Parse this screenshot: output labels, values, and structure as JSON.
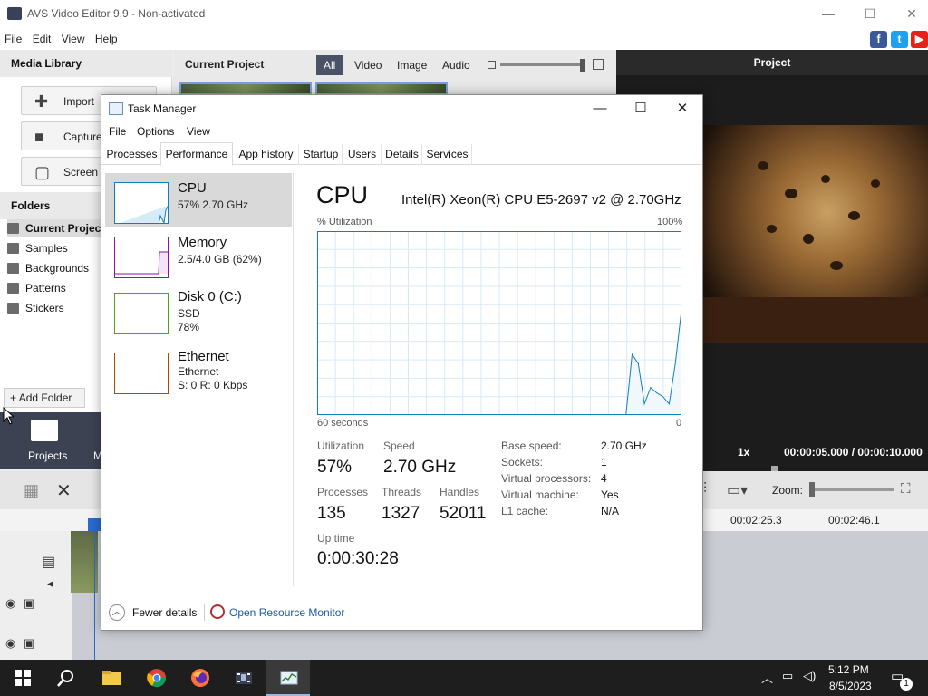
{
  "avs": {
    "window_title": "AVS Video Editor 9.9 - Non-activated",
    "menu": [
      "File",
      "Edit",
      "View",
      "Help"
    ],
    "social": [
      {
        "icon": "facebook-icon",
        "glyph": "f",
        "color": "#3b5998"
      },
      {
        "icon": "twitter-icon",
        "glyph": "t",
        "color": "#1da1f2"
      },
      {
        "icon": "youtube-icon",
        "glyph": "▶",
        "color": "#e62117"
      }
    ],
    "media_library": {
      "title": "Media Library",
      "buttons": [
        {
          "label": "Import",
          "icon": "plus-icon"
        },
        {
          "label": "Capture",
          "icon": "camera-icon"
        },
        {
          "label": "Screen C",
          "icon": "screen-capture-icon"
        }
      ],
      "folders_title": "Folders",
      "folders": [
        "Current Project",
        "Samples",
        "Backgrounds",
        "Patterns",
        "Stickers"
      ],
      "add_folder": "Add Folder"
    },
    "current_project": {
      "title": "Current Project",
      "filters": [
        "All",
        "Video",
        "Image",
        "Audio"
      ],
      "active_filter": "All"
    },
    "preview": {
      "title": "Project",
      "speed": "1x",
      "time": "00:00:05.000 / 00:00:10.000"
    },
    "projects_label": "Projects",
    "projects_label_partial": "M",
    "zoom_label": "Zoom:",
    "ruler_times": [
      "00:02:25.3",
      "00:02:46.1"
    ]
  },
  "task_manager": {
    "title": "Task Manager",
    "menu": [
      "File",
      "Options",
      "View"
    ],
    "tabs": [
      "Processes",
      "Performance",
      "App history",
      "Startup",
      "Users",
      "Details",
      "Services"
    ],
    "active_tab": "Performance",
    "resources": [
      {
        "name": "CPU",
        "sub1": "57% 2.70 GHz",
        "sub2": "",
        "color": "#117dbb"
      },
      {
        "name": "Memory",
        "sub1": "2.5/4.0 GB (62%)",
        "sub2": "",
        "color": "#8b12ae"
      },
      {
        "name": "Disk 0 (C:)",
        "sub1": "SSD",
        "sub2": "78%",
        "color": "#4da60c"
      },
      {
        "name": "Ethernet",
        "sub1": "Ethernet",
        "sub2": "S: 0 R: 0 Kbps",
        "color": "#a74f01"
      }
    ],
    "cpu": {
      "heading": "CPU",
      "model": "Intel(R) Xeon(R) CPU E5-2697 v2 @ 2.70GHz",
      "util_axis_label": "% Utilization",
      "util_axis_max": "100%",
      "time_axis_left": "60 seconds",
      "time_axis_right": "0",
      "graph_values": [
        0,
        0,
        0,
        0,
        0,
        0,
        0,
        0,
        0,
        0,
        0,
        0,
        0,
        0,
        0,
        0,
        0,
        0,
        0,
        0,
        0,
        0,
        0,
        0,
        0,
        0,
        0,
        0,
        0,
        0,
        0,
        0,
        0,
        0,
        0,
        0,
        0,
        0,
        0,
        0,
        0,
        0,
        0,
        0,
        0,
        0,
        0,
        0,
        0,
        0,
        0,
        33,
        28,
        6,
        15,
        12,
        10,
        6,
        28,
        57
      ],
      "metrics": {
        "utilization_label": "Utilization",
        "utilization": "57%",
        "speed_label": "Speed",
        "speed": "2.70 GHz",
        "processes_label": "Processes",
        "processes": "135",
        "threads_label": "Threads",
        "threads": "1327",
        "handles_label": "Handles",
        "handles": "52011",
        "uptime_label": "Up time",
        "uptime": "0:00:30:28"
      },
      "specs": [
        {
          "key": "Base speed:",
          "value": "2.70 GHz"
        },
        {
          "key": "Sockets:",
          "value": "1"
        },
        {
          "key": "Virtual processors:",
          "value": "4"
        },
        {
          "key": "Virtual machine:",
          "value": "Yes"
        },
        {
          "key": "L1 cache:",
          "value": "N/A"
        }
      ]
    },
    "footer": {
      "fewer_details": "Fewer details",
      "open_resource_monitor": "Open Resource Monitor"
    }
  },
  "taskbar": {
    "apps": [
      {
        "name": "start-button",
        "icon": "windows-icon",
        "active": false
      },
      {
        "name": "search-button",
        "icon": "search-icon",
        "active": false
      },
      {
        "name": "file-explorer-button",
        "icon": "folder-icon",
        "active": false
      },
      {
        "name": "chrome-button",
        "icon": "chrome-icon",
        "active": false
      },
      {
        "name": "firefox-button",
        "icon": "firefox-icon",
        "active": false
      },
      {
        "name": "avs-video-editor-button",
        "icon": "film-icon",
        "active": false
      },
      {
        "name": "task-manager-button",
        "icon": "task-manager-icon",
        "active": true
      }
    ],
    "time": "5:12 PM",
    "date": "8/5/2023",
    "notification_count": "1"
  }
}
